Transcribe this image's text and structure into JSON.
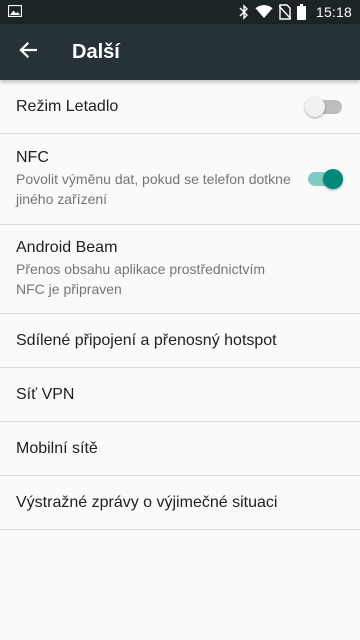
{
  "status_bar": {
    "time": "15:18",
    "icons": [
      "image-icon",
      "bluetooth-icon",
      "wifi-icon",
      "no-sim-icon",
      "battery-icon"
    ]
  },
  "app_bar": {
    "title": "Další",
    "back_icon": "arrow-back-icon",
    "background": "#263238"
  },
  "settings": {
    "airplane": {
      "title": "Režim Letadlo",
      "enabled": false
    },
    "nfc": {
      "title": "NFC",
      "summary": "Povolit výměnu dat, pokud se telefon dotkne jiného zařízení",
      "enabled": true
    },
    "android_beam": {
      "title": "Android Beam",
      "summary": "Přenos obsahu aplikace prostřednictvím NFC je připraven"
    },
    "tethering": {
      "title": "Sdílené připojení a přenosný hotspot"
    },
    "vpn": {
      "title": "Síť VPN"
    },
    "mobile_networks": {
      "title": "Mobilní sítě"
    },
    "emergency_alerts": {
      "title": "Výstražné zprávy o výjimečné situaci"
    }
  },
  "colors": {
    "accent": "#00897b",
    "accent_track": "#80cbc4",
    "status_bar": "#1d2428"
  }
}
